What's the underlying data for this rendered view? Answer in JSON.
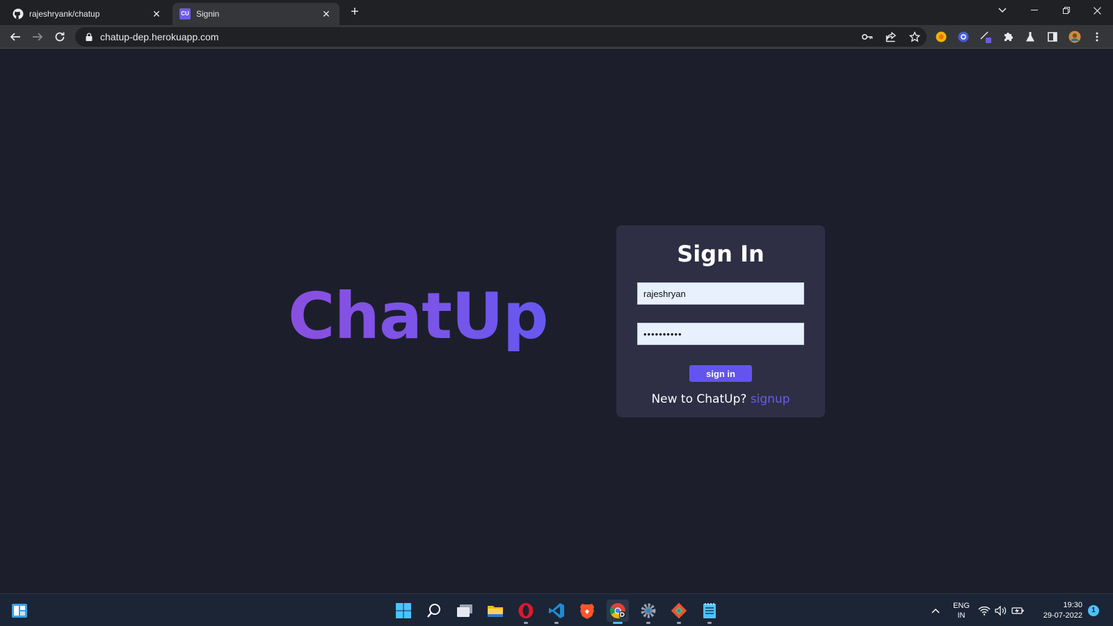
{
  "browser": {
    "tabs": [
      {
        "label": "rajeshryank/chatup",
        "icon": "github-icon",
        "active": false
      },
      {
        "label": "Signin",
        "icon": "chatup-favicon",
        "favicon_text": "CU",
        "active": true
      }
    ],
    "new_tab_label": "+",
    "url": "chatup-dep.herokuapp.com"
  },
  "page": {
    "brand": "ChatUp",
    "form": {
      "heading": "Sign In",
      "username_value": "rajeshryan",
      "password_value": "••••••••••",
      "submit_label": "sign in",
      "prompt_text": "New to ChatUp?",
      "signup_link": "signup"
    }
  },
  "taskbar": {
    "language_line1": "ENG",
    "language_line2": "IN",
    "time": "19:30",
    "date": "29-07-2022",
    "notification_count": "1"
  },
  "colors": {
    "page_bg": "#1c1f2b",
    "card_bg": "#2e2f45",
    "accent": "#6354f0",
    "link": "#6c5ce7",
    "brand_gradient_start": "#8a4fe0",
    "brand_gradient_end": "#6658f0"
  }
}
